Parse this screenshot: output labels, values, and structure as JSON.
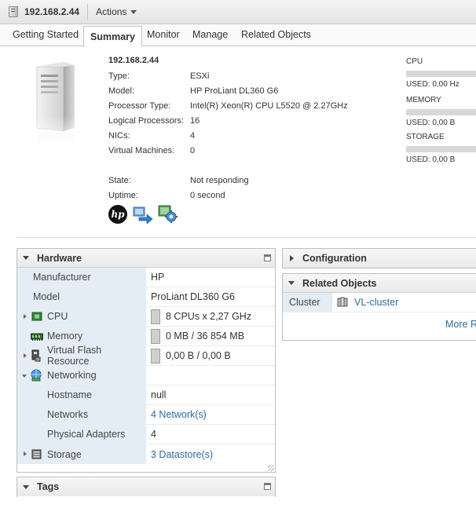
{
  "header": {
    "host_title": "192.168.2.44",
    "actions_label": "Actions"
  },
  "tabs": [
    {
      "label": "Getting Started"
    },
    {
      "label": "Summary",
      "active": true
    },
    {
      "label": "Monitor"
    },
    {
      "label": "Manage"
    },
    {
      "label": "Related Objects"
    }
  ],
  "summary": {
    "host": "192.168.2.44",
    "rows": [
      {
        "key": "Type:",
        "value": "ESXi"
      },
      {
        "key": "Model:",
        "value": "HP ProLiant DL360 G6"
      },
      {
        "key": "Processor Type:",
        "value": "Intel(R) Xeon(R) CPU L5520 @ 2.27GHz"
      },
      {
        "key": "Logical Processors:",
        "value": "16"
      },
      {
        "key": "NICs:",
        "value": "4"
      },
      {
        "key": "Virtual Machines:",
        "value": "0"
      },
      {
        "key": "State:",
        "value": "Not responding"
      },
      {
        "key": "Uptime:",
        "value": "0 second"
      }
    ],
    "logo_text": "hp"
  },
  "resources": [
    {
      "label": "CPU",
      "used": "USED: 0,00 Hz",
      "usage_percent": 0
    },
    {
      "label": "MEMORY",
      "used": "USED: 0,00 B",
      "usage_percent": 0
    },
    {
      "label": "STORAGE",
      "used": "USED: 0,00 B",
      "usage_percent": 0
    }
  ],
  "hardware": {
    "title": "Hardware",
    "rows": [
      {
        "key": "Manufacturer",
        "value": "HP"
      },
      {
        "key": "Model",
        "value": "ProLiant DL360 G6"
      },
      {
        "key": "CPU",
        "value": "8 CPUs x 2,27 GHz",
        "icon": "cpu-icon"
      },
      {
        "key": "Memory",
        "value": "0 MB / 36 854 MB",
        "icon": "memory-icon"
      },
      {
        "key": "Virtual Flash Resource",
        "value": "0,00 B / 0,00 B",
        "icon": "flash-icon"
      },
      {
        "key": "Networking",
        "value": "",
        "icon": "network-icon"
      },
      {
        "key": "Hostname",
        "value": "null"
      },
      {
        "key": "Networks",
        "value": "4 Network(s)"
      },
      {
        "key": "Physical Adapters",
        "value": "4"
      },
      {
        "key": "Storage",
        "value": "3 Datastore(s)",
        "icon": "storage-icon"
      }
    ]
  },
  "tags": {
    "title": "Tags"
  },
  "configuration": {
    "title": "Configuration"
  },
  "related_objects": {
    "title": "Related Objects",
    "cluster_key": "Cluster",
    "cluster_value": "VL-cluster",
    "more_label": "More R"
  }
}
